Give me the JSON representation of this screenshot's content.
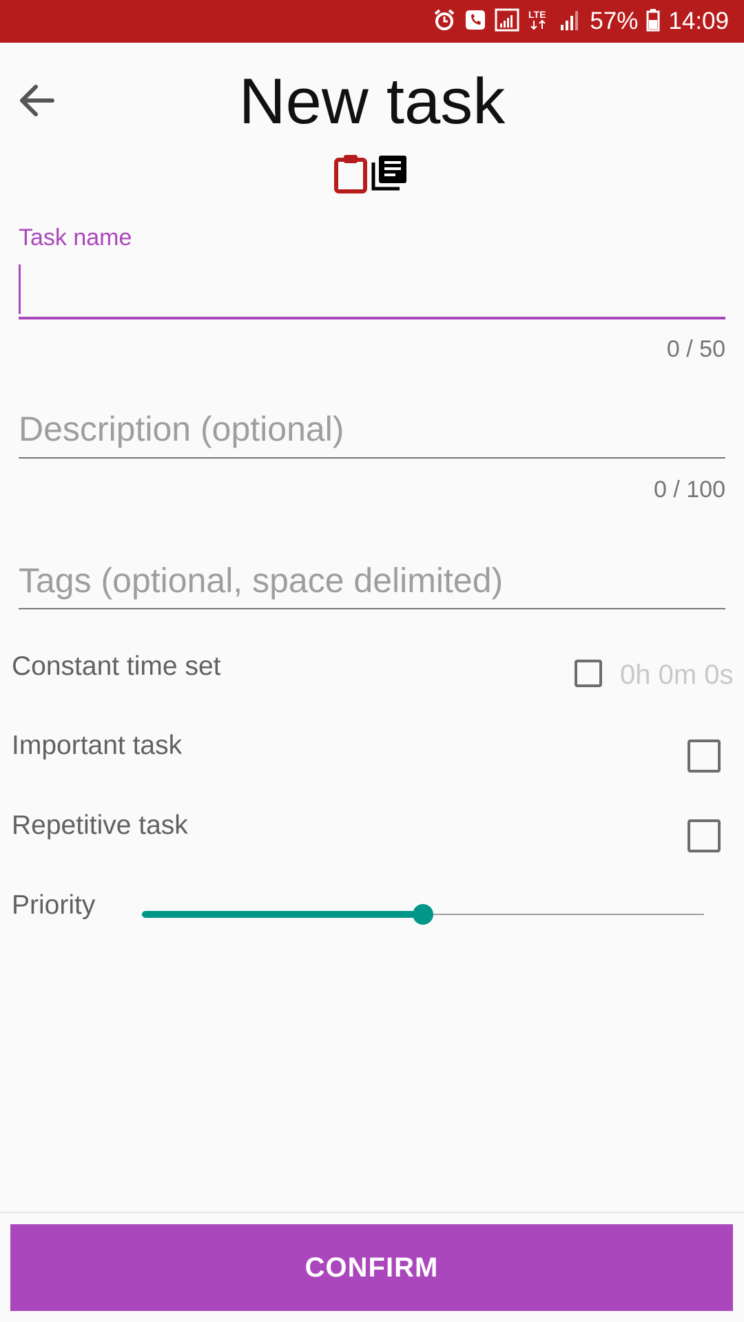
{
  "status_bar": {
    "battery": "57%",
    "time": "14:09",
    "network": "LTE",
    "icons": [
      "alarm-icon",
      "phone-call-icon",
      "signal-icon",
      "lte-icon",
      "signal-bars-icon",
      "battery-icon"
    ]
  },
  "header": {
    "title": "New task",
    "icons": [
      "clipboard-icon",
      "library-books-icon"
    ],
    "back_icon": "arrow-back-icon"
  },
  "form": {
    "task_name": {
      "label": "Task name",
      "value": "",
      "counter": "0 / 50"
    },
    "description": {
      "placeholder": "Description (optional)",
      "counter": "0 / 100"
    },
    "tags": {
      "placeholder": "Tags (optional, space delimited)"
    }
  },
  "options": {
    "constant_time": {
      "label": "Constant time set",
      "checked": false,
      "time": "0h 0m 0s"
    },
    "important": {
      "label": "Important task",
      "checked": false
    },
    "repetitive": {
      "label": "Repetitive task",
      "checked": false
    }
  },
  "priority": {
    "label": "Priority",
    "value": 0.5
  },
  "actions": {
    "confirm_label": "CONFIRM"
  },
  "colors": {
    "accent": "#ab47bc",
    "status_bar": "#b71c1c",
    "slider": "#009688",
    "clipboard": "#b71c1c"
  }
}
